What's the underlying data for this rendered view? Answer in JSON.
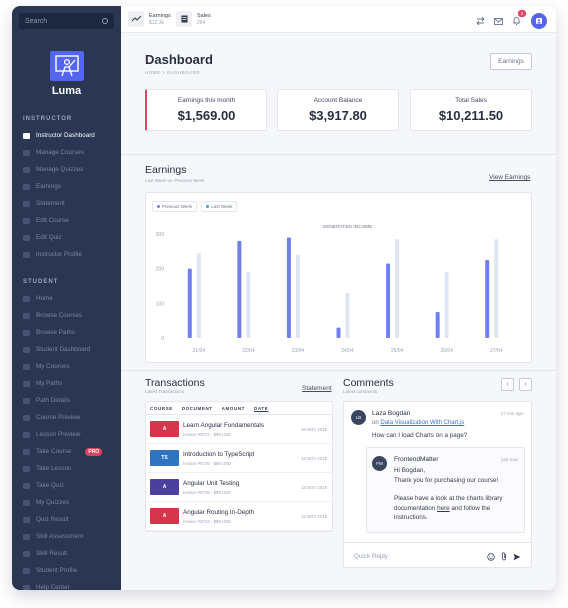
{
  "sidebar": {
    "search_placeholder": "Search",
    "brand": "Luma",
    "instructor_title": "INSTRUCTOR",
    "instructor_items": [
      {
        "label": "Instructor Dashboard",
        "active": true
      },
      {
        "label": "Manage Courses"
      },
      {
        "label": "Manage Quizzes"
      },
      {
        "label": "Earnings"
      },
      {
        "label": "Statement"
      },
      {
        "label": "Edit Course"
      },
      {
        "label": "Edit Quiz"
      },
      {
        "label": "Instructor Profile"
      }
    ],
    "student_title": "STUDENT",
    "student_items": [
      {
        "label": "Home"
      },
      {
        "label": "Browse Courses"
      },
      {
        "label": "Browse Paths"
      },
      {
        "label": "Student Dashboard"
      },
      {
        "label": "My Courses"
      },
      {
        "label": "My Paths"
      },
      {
        "label": "Path Details"
      },
      {
        "label": "Course Preview"
      },
      {
        "label": "Lesson Preview"
      },
      {
        "label": "Take Course",
        "badge": "PRO"
      },
      {
        "label": "Take Lesson"
      },
      {
        "label": "Take Quiz"
      },
      {
        "label": "My Quizzes"
      },
      {
        "label": "Quiz Result"
      },
      {
        "label": "Skill Assessment"
      },
      {
        "label": "Skill Result"
      },
      {
        "label": "Student Profile"
      },
      {
        "label": "Help Center"
      }
    ]
  },
  "topbar": {
    "earnings_label": "Earnings",
    "earnings_value": "$12.3k",
    "sales_label": "Sales",
    "sales_value": "264",
    "notification_count": "2"
  },
  "header": {
    "title": "Dashboard",
    "breadcrumb": "HOME > DASHBOARD",
    "earnings_button": "Earnings"
  },
  "stats": [
    {
      "label": "Earnings this month",
      "value": "$1,569.00"
    },
    {
      "label": "Account Balance",
      "value": "$3,917.80"
    },
    {
      "label": "Total Sales",
      "value": "$10,211.50"
    }
  ],
  "earnings_section": {
    "title": "Earnings",
    "subtitle": "Last Week vs. Previous Week",
    "link": "View Earnings"
  },
  "chart_data": {
    "type": "bar",
    "title": "GENERATED INCOME",
    "categories": [
      "21/04",
      "22/04",
      "23/04",
      "24/04",
      "25/04",
      "26/04",
      "27/04"
    ],
    "ylim": [
      0,
      300
    ],
    "yticks": [
      "0",
      "100",
      "200",
      "300"
    ],
    "series": [
      {
        "name": "Last Week",
        "color": "#6f7ff0",
        "values": [
          200,
          280,
          290,
          30,
          215,
          75,
          225
        ]
      },
      {
        "name": "Previous Week",
        "color": "#dfe4f2",
        "values": [
          245,
          190,
          240,
          130,
          285,
          190,
          285
        ]
      }
    ],
    "legend": [
      "Previous Week",
      "Last Week"
    ],
    "legend_colors": [
      "#6f7ff0",
      "#2aa7e6"
    ]
  },
  "transactions": {
    "title": "Transactions",
    "subtitle": "Latest Transactions",
    "link": "Statement",
    "columns": [
      "COURSE",
      "DOCUMENT",
      "AMOUNT",
      "DATE"
    ],
    "rows": [
      {
        "title": "Learn Angular Fundamentals",
        "invoice": "Invoice #8737 - $89 USD",
        "date": "15 NOV 2018",
        "thumb": "A",
        "color": "#d5364b"
      },
      {
        "title": "Introduction to TypeScript",
        "invoice": "Invoice #8736 - $89 USD",
        "date": "14 NOV 2018",
        "thumb": "TS",
        "color": "#2f74c0"
      },
      {
        "title": "Angular Unit Testing",
        "invoice": "Invoice #8735 - $89 USD",
        "date": "13 NOV 2018",
        "thumb": "A",
        "color": "#4b3f9f"
      },
      {
        "title": "Angular Routing In-Depth",
        "invoice": "Invoice #8734 - $89 USD",
        "date": "12 NOV 2018",
        "thumb": "A",
        "color": "#d5364b"
      }
    ]
  },
  "comments": {
    "title": "Comments",
    "subtitle": "Latest comments",
    "first": {
      "initials": "LB",
      "author": "Laza Bogdan",
      "time": "27 min ago",
      "on_prefix": "on",
      "on_link": "Data Visualization With Chart.js",
      "text": "How can I load Charts on a page?"
    },
    "reply": {
      "initials": "FM",
      "author": "FrontendMatter",
      "time": "just now",
      "greeting": "Hi Bogdan,",
      "line1": "Thank you for purchasing our course!",
      "line2": "Please have a look at the charts library",
      "line3_pre": "documentation",
      "line3_link": "here",
      "line3_post": "and follow the",
      "line4": "instructions."
    },
    "quick_reply_placeholder": "Quick Reply"
  }
}
